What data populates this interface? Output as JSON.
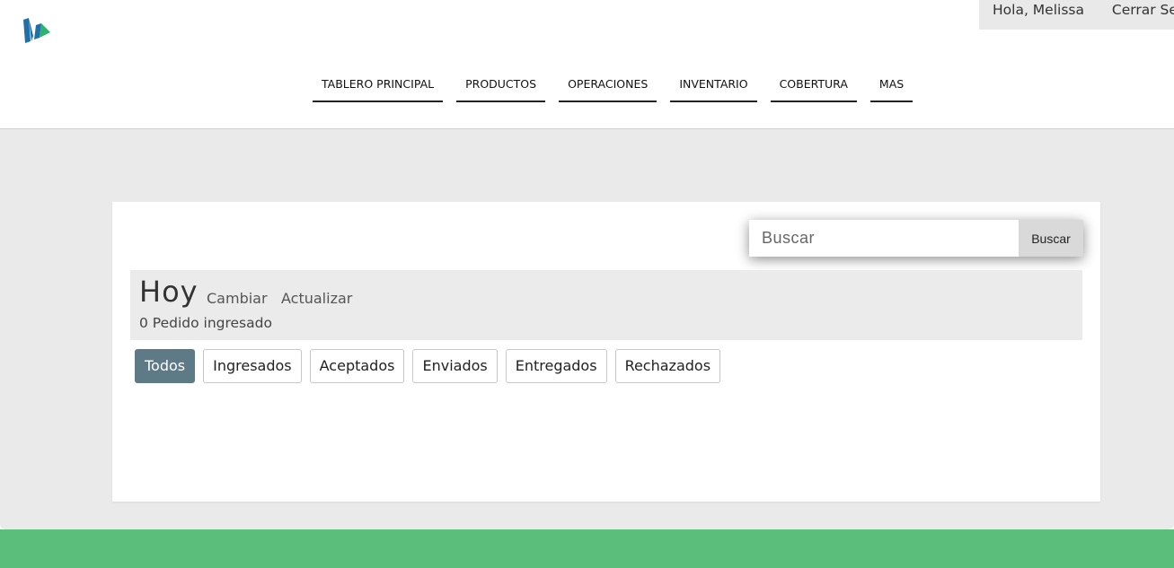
{
  "header": {
    "logo_icon": "brand-logo-icon",
    "greeting": "Hola, Melissa",
    "logout": "Cerrar Sesión"
  },
  "nav": {
    "items": [
      {
        "label": "TABLERO PRINCIPAL"
      },
      {
        "label": "PRODUCTOS"
      },
      {
        "label": "OPERACIONES"
      },
      {
        "label": "INVENTARIO"
      },
      {
        "label": "COBERTURA"
      },
      {
        "label": "MAS"
      }
    ]
  },
  "search": {
    "placeholder": "Buscar",
    "value": "",
    "button_label": "Buscar"
  },
  "day": {
    "title": "Hoy",
    "change_label": "Cambiar",
    "refresh_label": "Actualizar",
    "count_text": "0 Pedido ingresado"
  },
  "filters": {
    "active": "Todos",
    "items": [
      {
        "label": "Todos"
      },
      {
        "label": "Ingresados"
      },
      {
        "label": "Aceptados"
      },
      {
        "label": "Enviados"
      },
      {
        "label": "Entregados"
      },
      {
        "label": "Rechazados"
      }
    ]
  },
  "colors": {
    "accent_green": "#5bbe7a",
    "active_filter": "#5f7a87",
    "logo_blue": "#1f6fa8",
    "logo_green": "#2db36b"
  }
}
